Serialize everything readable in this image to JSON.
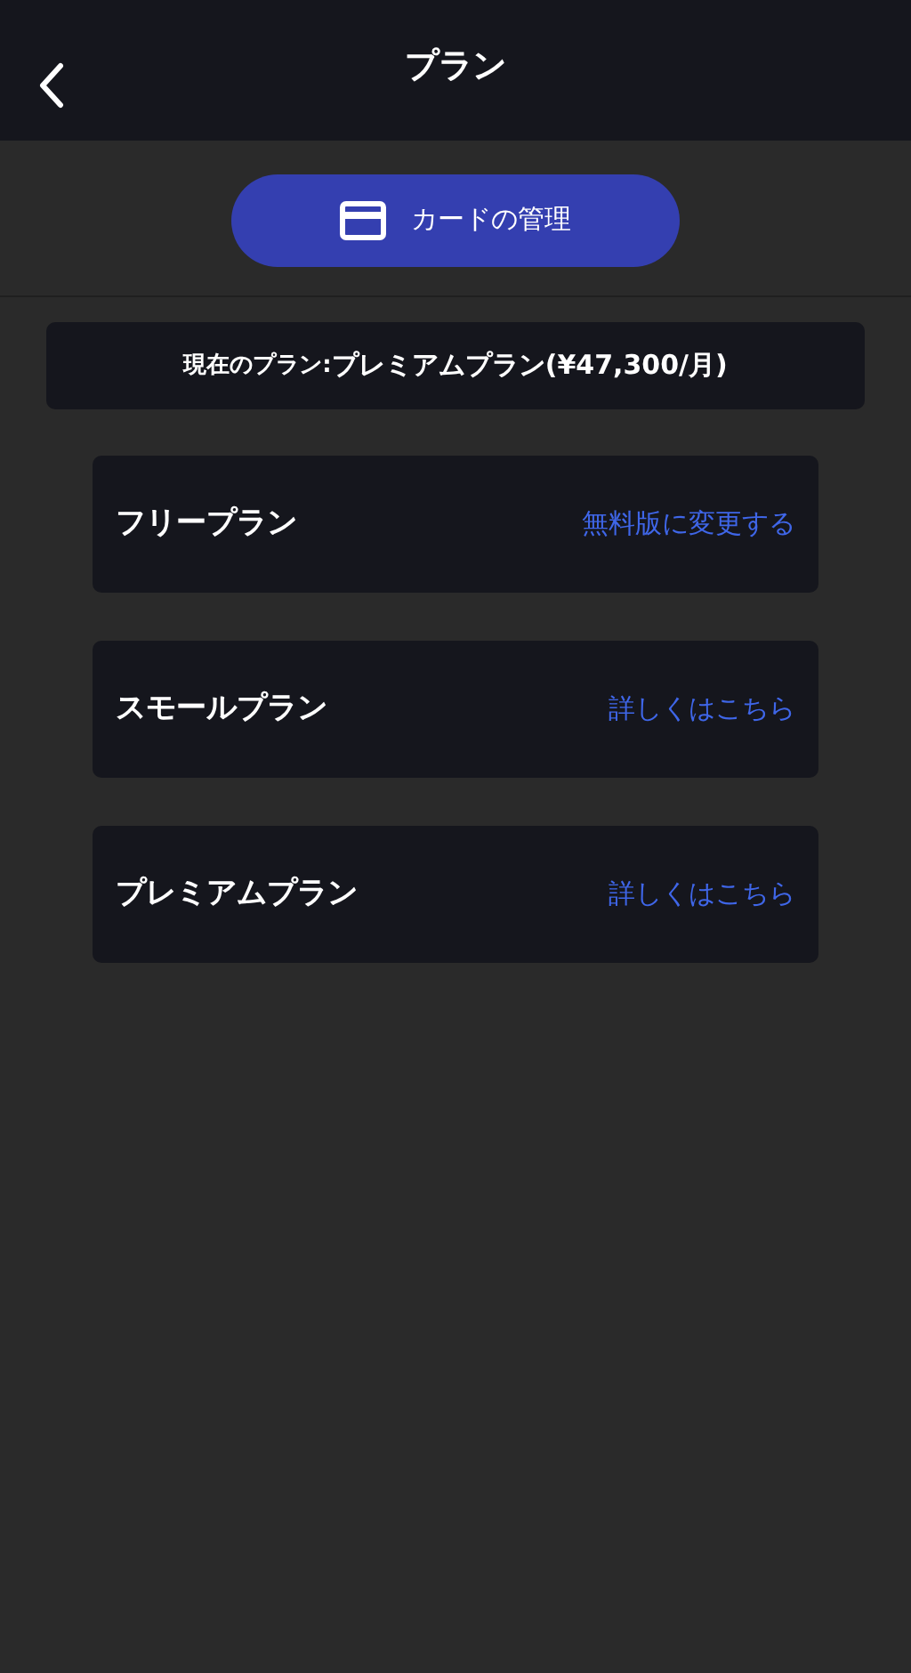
{
  "header": {
    "title": "プラン"
  },
  "card_button": {
    "label": "カードの管理"
  },
  "current_plan": {
    "label": "現在のプラン:",
    "value": "プレミアムプラン(¥47,300/月)"
  },
  "plans": [
    {
      "name": "フリープラン",
      "link": "無料版に変更する"
    },
    {
      "name": "スモールプラン",
      "link": "詳しくはこちら"
    },
    {
      "name": "プレミアムプラン",
      "link": "詳しくはこちら"
    }
  ]
}
